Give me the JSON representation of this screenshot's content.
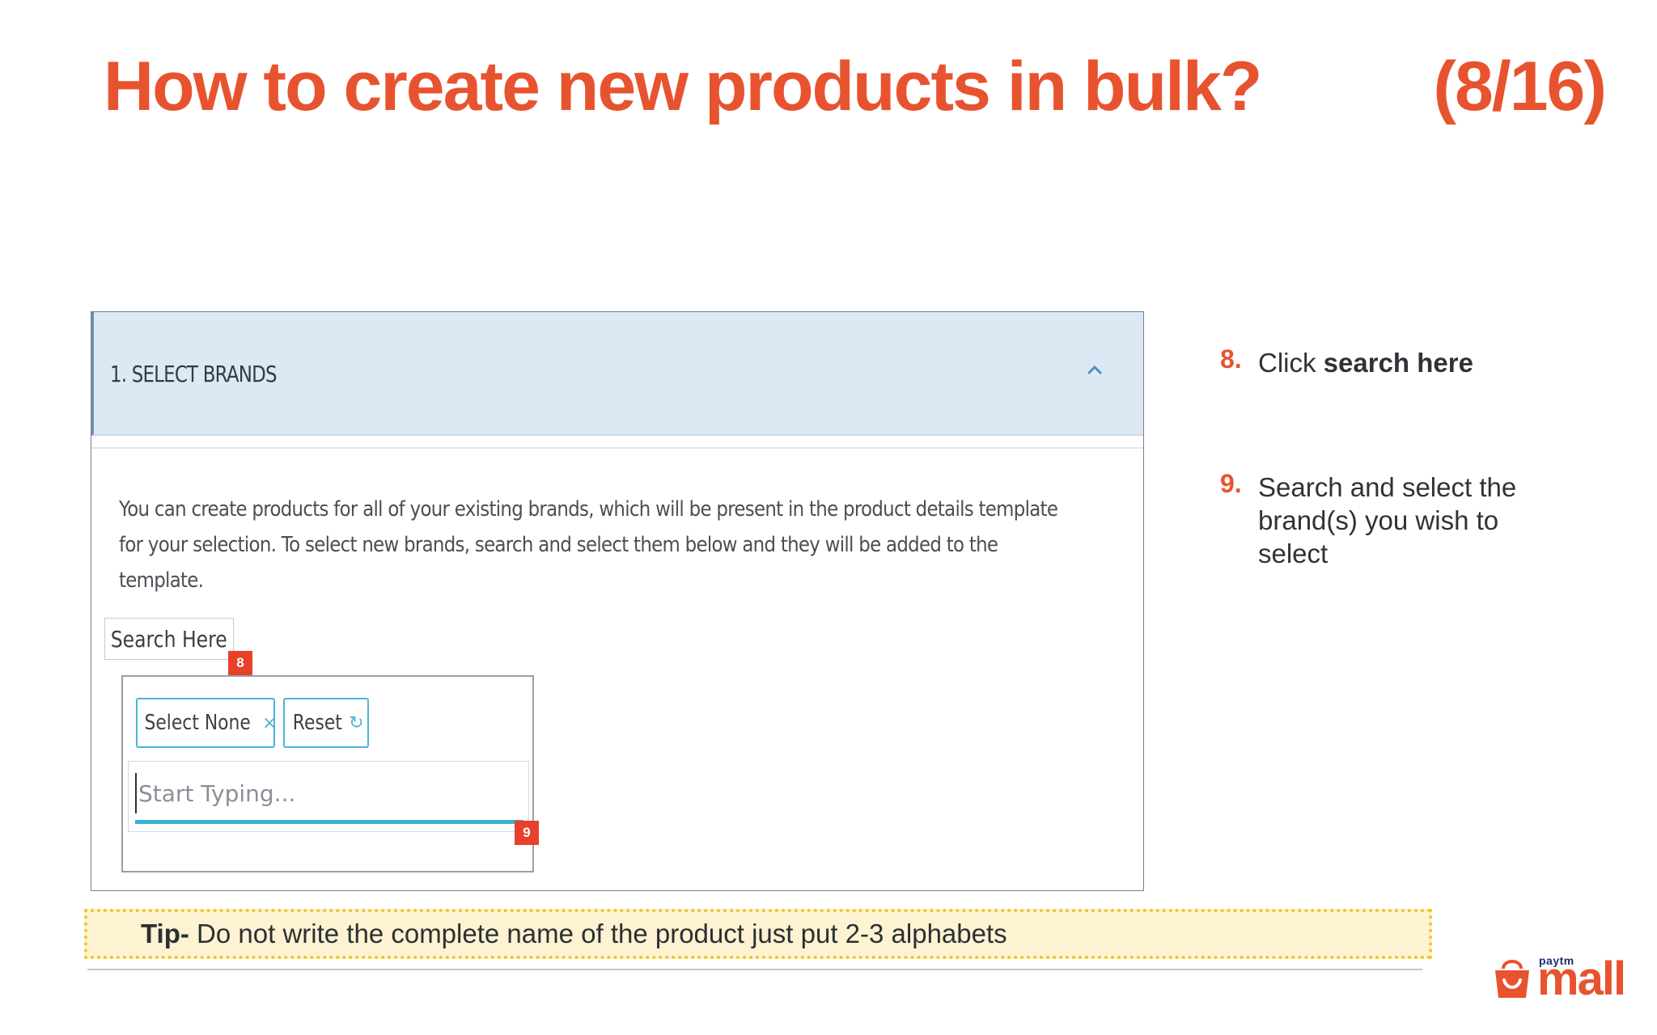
{
  "slide": {
    "title": "How to create new products in bulk?",
    "counter": "(8/16)"
  },
  "panel": {
    "header_title": "1. SELECT BRANDS",
    "collapse_icon": "chevron-up-icon",
    "description": "You can create products for all of your existing brands, which will be present in the product details template for your selection. To select new brands, search and select them below and they will be added to the template.",
    "search_button_label": "Search Here",
    "badge_search": "8",
    "select_none_label": "Select None",
    "select_none_icon": "×",
    "reset_label": "Reset",
    "reset_icon": "↻",
    "typing_placeholder": "Start Typing...",
    "badge_typing": "9"
  },
  "steps": [
    {
      "number": "8.",
      "text_prefix": "Click ",
      "text_bold": "search here",
      "text_suffix": ""
    },
    {
      "number": "9.",
      "text_prefix": "Search and select the brand(s) you wish to select",
      "text_bold": "",
      "text_suffix": ""
    }
  ],
  "tip": {
    "label": "Tip-",
    "text": " Do not write the complete name of the product just put  2-3 alphabets"
  },
  "logo": {
    "small": "paytm",
    "big": "mall",
    "icon": "shopping-bag-icon"
  },
  "colors": {
    "accent": "#e8532f",
    "header_bg": "#dce9f5",
    "pill_border": "#4bb6d6",
    "tip_bg": "#fdf3d2",
    "tip_border": "#f2c52b",
    "badge": "#e8402a"
  }
}
